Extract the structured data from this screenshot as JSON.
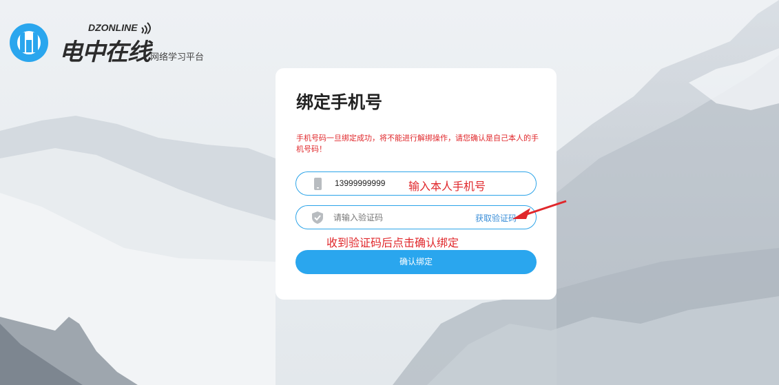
{
  "logo": {
    "cn": "电中在线",
    "en": "DZONLINE",
    "subtitle": "网络学习平台"
  },
  "card": {
    "title": "绑定手机号",
    "warning": "手机号码一旦绑定成功，将不能进行解绑操作，请您确认是自己本人的手机号码！",
    "phone_value": "13999999999",
    "code_placeholder": "请输入验证码",
    "get_code_label": "获取验证码",
    "confirm_label": "确认绑定"
  },
  "annotations": {
    "phone_note": "输入本人手机号",
    "code_note": "收到验证码后点击确认绑定"
  },
  "colors": {
    "accent": "#2aa6ee",
    "warning": "#e0272b",
    "link": "#3a8ed8"
  },
  "icons": {
    "phone": "phone-icon",
    "code": "shield-icon",
    "logo": "logo-mark"
  }
}
